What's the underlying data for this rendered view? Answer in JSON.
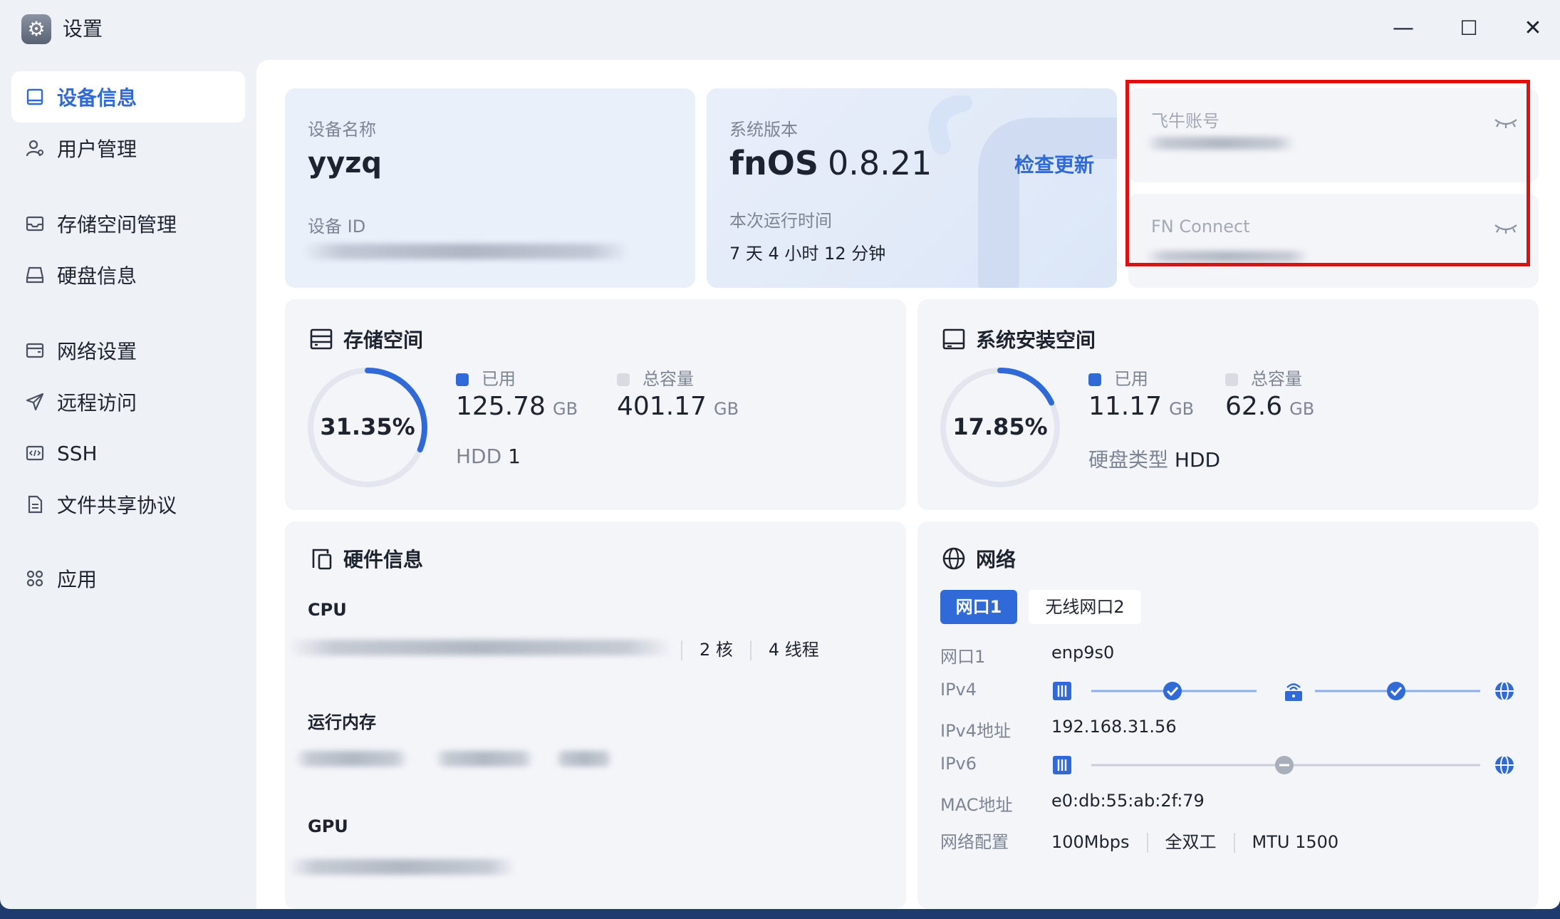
{
  "window": {
    "title": "设置",
    "controls": {
      "minimize": "—",
      "maximize": "☐",
      "close": "✕"
    }
  },
  "sidebar": {
    "items": [
      {
        "label": "设备信息",
        "icon": "monitor-icon",
        "active": true
      },
      {
        "label": "用户管理",
        "icon": "user-icon",
        "active": false
      },
      {
        "label": "存储空间管理",
        "icon": "inbox-icon",
        "active": false
      },
      {
        "label": "硬盘信息",
        "icon": "hard-drive-icon",
        "active": false
      },
      {
        "label": "网络设置",
        "icon": "network-panel-icon",
        "active": false
      },
      {
        "label": "远程访问",
        "icon": "send-icon",
        "active": false
      },
      {
        "label": "SSH",
        "icon": "code-icon",
        "active": false
      },
      {
        "label": "文件共享协议",
        "icon": "document-icon",
        "active": false
      },
      {
        "label": "应用",
        "icon": "apps-icon",
        "active": false
      }
    ]
  },
  "device": {
    "name_label": "设备名称",
    "name_value": "yyzq",
    "id_label": "设备 ID"
  },
  "system": {
    "version_label": "系统版本",
    "os_name": "fnOS",
    "version": "0.8.21",
    "check_update": "检查更新",
    "uptime_label": "本次运行时间",
    "uptime_value": "7 天 4 小时 12 分钟"
  },
  "account": {
    "feiniu_label": "飞牛账号",
    "fnconnect_label": "FN Connect"
  },
  "storage": {
    "title": "存储空间",
    "percent_text": "31.35%",
    "percent": 31.35,
    "used_label": "已用",
    "used_value": "125.78",
    "used_unit": "GB",
    "total_label": "总容量",
    "total_value": "401.17",
    "total_unit": "GB",
    "disk_type": "HDD",
    "disk_count": "1"
  },
  "system_space": {
    "title": "系统安装空间",
    "percent_text": "17.85%",
    "percent": 17.85,
    "used_label": "已用",
    "used_value": "11.17",
    "used_unit": "GB",
    "total_label": "总容量",
    "total_value": "62.6",
    "total_unit": "GB",
    "disk_type_label": "硬盘类型",
    "disk_type_value": "HDD"
  },
  "hardware": {
    "title": "硬件信息",
    "cpu_label": "CPU",
    "cores": "2 核",
    "threads": "4 线程",
    "memory_label": "运行内存",
    "gpu_label": "GPU"
  },
  "network": {
    "title": "网络",
    "tabs": [
      "网口1",
      "无线网口2"
    ],
    "active_tab": 0,
    "rows": {
      "port_label": "网口1",
      "port_value": "enp9s0",
      "ipv4_label": "IPv4",
      "ipv4_addr_label": "IPv4地址",
      "ipv4_addr_value": "192.168.31.56",
      "ipv6_label": "IPv6",
      "mac_label": "MAC地址",
      "mac_value": "e0:db:55:ab:2f:79",
      "config_label": "网络配置",
      "speed": "100Mbps",
      "duplex": "全双工",
      "mtu": "MTU 1500"
    }
  },
  "colors": {
    "accent": "#2f6ad8",
    "ring_track": "#e3e6ee",
    "highlight_box": "#e01010",
    "gray_legend": "#d8dbe2"
  }
}
